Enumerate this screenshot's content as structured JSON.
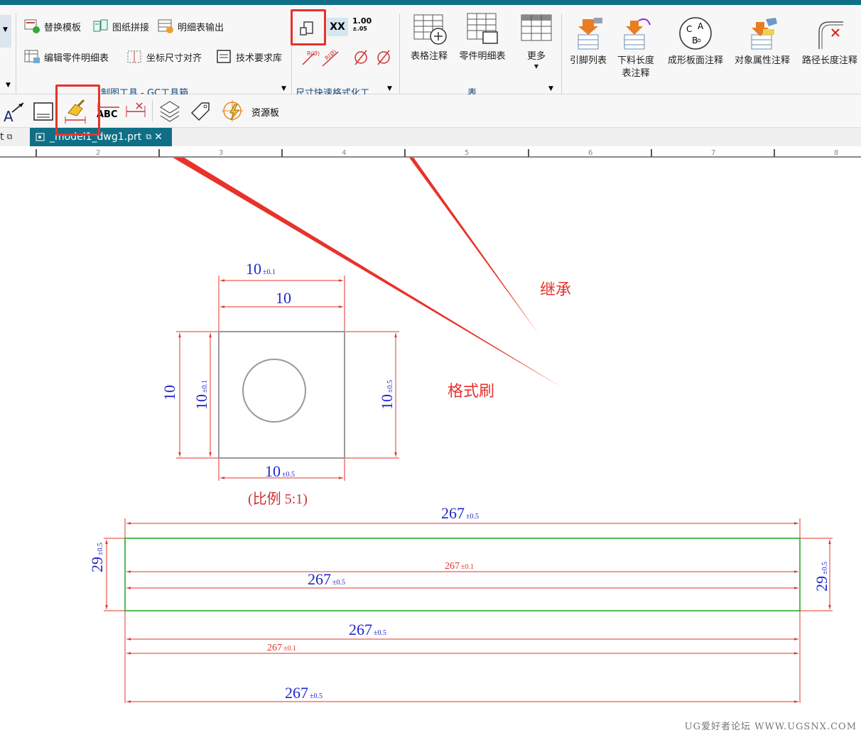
{
  "ribbon": {
    "gc_group": {
      "items": [
        "替换模板",
        "图纸拼接",
        "明细表输出",
        "编辑零件明细表",
        "坐标尺寸对齐",
        "技术要求库"
      ],
      "label": "制图工具 - GC工具箱"
    },
    "dim_group": {
      "label": "尺寸快速格式化工...",
      "xx_label": "XX",
      "dec_value": "1.00",
      "dec_tol": "±.05"
    },
    "table_group": {
      "items": [
        "表格注释",
        "零件明细表",
        "更多"
      ],
      "label": "表"
    },
    "right_group": {
      "items": [
        "引脚列表",
        "下料长度\n表注释",
        "成形板面注释",
        "对象属性注释",
        "路径长度注释"
      ]
    }
  },
  "toolbar2": {
    "abc_label": "ABC",
    "resource_label": "资源板"
  },
  "tabs": {
    "left_fragment": "t",
    "active": "_model1_dwg1.prt"
  },
  "ruler": {
    "ticks": [
      "2",
      "3",
      "4",
      "5",
      "6",
      "7",
      "8"
    ]
  },
  "annotations": {
    "inherit": "继承",
    "format_brush": "格式刷"
  },
  "drawing": {
    "top_view": {
      "dims": [
        {
          "text": "10",
          "tol": "±0.1"
        },
        {
          "text": "10",
          "tol": ""
        },
        {
          "text": "10",
          "tol": ""
        },
        {
          "text": "10",
          "tol": "±0.1"
        },
        {
          "text": "10",
          "tol": "±0.5"
        },
        {
          "text": "10",
          "tol": "±0.5"
        }
      ],
      "scale_label": "(比例 5:1)"
    },
    "bar_view": {
      "dims": [
        {
          "text": "267",
          "tol": "±0.5"
        },
        {
          "text": "29",
          "tol": "±0.5"
        },
        {
          "text": "267",
          "tol": "±0.1"
        },
        {
          "text": "267",
          "tol": "±0.5"
        },
        {
          "text": "29",
          "tol": "±0.5"
        },
        {
          "text": "267",
          "tol": "±0.5"
        },
        {
          "text": "267",
          "tol": "±0.1"
        },
        {
          "text": "267",
          "tol": "±0.5"
        }
      ]
    }
  },
  "watermark": "UG爱好者论坛 WWW.UGSNX.COM",
  "colors": {
    "accent": "#0f6f86",
    "highlight": "#e8322a",
    "dim_blue": "#1f27c9",
    "dim_red": "#e0342a",
    "part_green": "#1aa31a"
  }
}
